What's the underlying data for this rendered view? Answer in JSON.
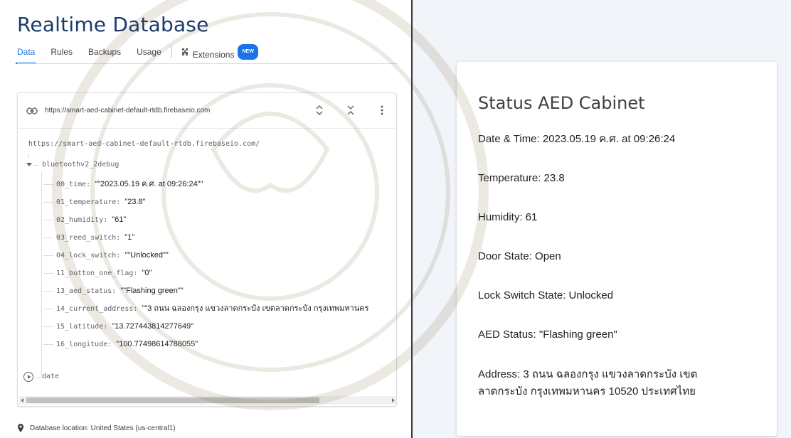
{
  "header": {
    "title": "Realtime Database",
    "tabs": [
      {
        "label": "Data"
      },
      {
        "label": "Rules"
      },
      {
        "label": "Backups"
      },
      {
        "label": "Usage"
      }
    ],
    "extensions_label": "Extensions",
    "new_badge": "NEW"
  },
  "database": {
    "url_bar": "https://smart-aed-cabinet-default-rtdb.firebaseio.com",
    "root_url": "https://smart-aed-cabinet-default-rtdb.firebaseio.com/",
    "node": "bluetoothv2_2debug",
    "children": [
      {
        "key": "00_time",
        "value": "\"\"2023.05.19 ค.ศ. at 09:26:24\"\""
      },
      {
        "key": "01_temperature",
        "value": "\"23.8\""
      },
      {
        "key": "02_humidity",
        "value": "\"61\""
      },
      {
        "key": "03_reed_switch",
        "value": "\"1\""
      },
      {
        "key": "04_lock_switch",
        "value": "\"\"Unlocked\"\""
      },
      {
        "key": "11_button_one_flag",
        "value": "\"0\""
      },
      {
        "key": "13_aed_status",
        "value": "\"\"Flashing green\"\""
      },
      {
        "key": "14_current_address",
        "value": "\"\"3 ถนน ฉลองกรุง แขวงลาดกระบัง เขตลาดกระบัง กรุงเทพมหานคร"
      },
      {
        "key": "15_latitude",
        "value": "\"13.727443814277649\""
      },
      {
        "key": "16_longitude",
        "value": "\"100.77498614788055\""
      }
    ],
    "collapsed_node": "date",
    "location": "Database location: United States (us-central1)"
  },
  "status_card": {
    "title": "Status AED Cabinet",
    "date_time": "Date & Time: 2023.05.19 ค.ศ. at 09:26:24",
    "temperature": "Temperature: 23.8",
    "humidity": "Humidity: 61",
    "door_state": "Door State: Open",
    "lock_state": "Lock Switch State: Unlocked",
    "aed_status": "AED Status: \"Flashing green\"",
    "address_line1": "Address: 3 ถนน ฉลองกรุง แขวงลาดกระบัง เขต",
    "address_line2": "ลาดกระบัง กรุงเทพมหานคร 10520 ประเทศไทย"
  },
  "colors": {
    "accent": "#1a73e8",
    "title_blue": "#1a3a6e",
    "right_bg": "#f1f4f8"
  }
}
